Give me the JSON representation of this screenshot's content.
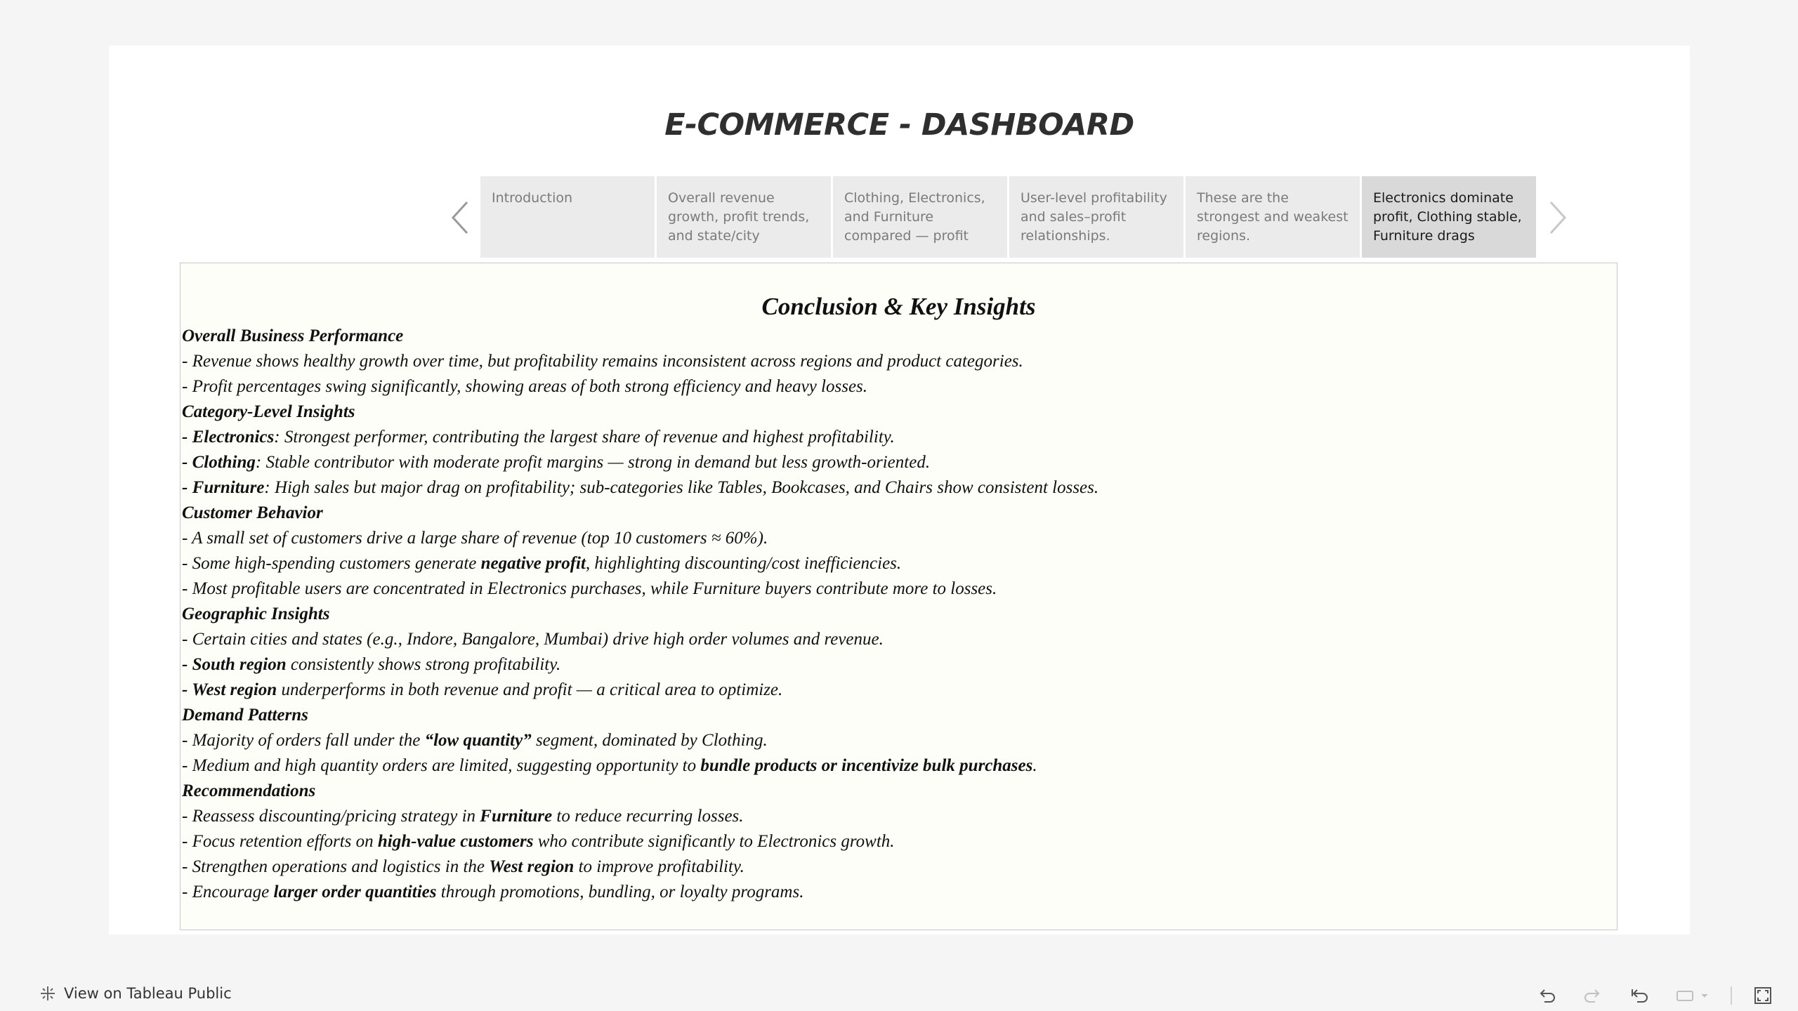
{
  "dashboard": {
    "title": "E-COMMERCE - DASHBOARD"
  },
  "story_points": [
    {
      "label": "Introduction",
      "active": false
    },
    {
      "label": "Overall revenue growth, profit trends, and state/city",
      "active": false
    },
    {
      "label": "Clothing, Electronics, and Furniture compared — profit",
      "active": false
    },
    {
      "label": "User-level profitability and sales–profit relationships.",
      "active": false
    },
    {
      "label": "These are the strongest and weakest regions.",
      "active": false
    },
    {
      "label": "Electronics dominate profit, Clothing stable, Furniture drags",
      "active": true
    }
  ],
  "content": {
    "heading": "Conclusion & Key Insights",
    "sections": {
      "overall": {
        "title": "Overall Business Performance",
        "line1": "- Revenue shows healthy growth over time, but profitability remains inconsistent across regions and product categories.",
        "line2": "- Profit percentages swing significantly, showing areas of both strong efficiency and heavy losses."
      },
      "category": {
        "title": "Category-Level Insights",
        "electronics_label": "- Electronics",
        "electronics_text": ": Strongest performer, contributing the largest share of revenue and highest profitability.",
        "clothing_label": "- Clothing",
        "clothing_text": ": Stable contributor with moderate profit margins — strong in demand but less growth-oriented.",
        "furniture_label": "- Furniture",
        "furniture_text": ": High sales but major drag on profitability; sub-categories like Tables, Bookcases, and Chairs show consistent losses."
      },
      "customer": {
        "title": "Customer Behavior",
        "line1": "- A small set of customers drive a large share of revenue (top 10 customers ≈ 60%).",
        "line2_pre": "- Some high-spending customers generate ",
        "line2_bold": "negative profit",
        "line2_post": ", highlighting discounting/cost inefficiencies.",
        "line3": "- Most profitable users are concentrated in Electronics purchases, while Furniture buyers contribute more to losses."
      },
      "geographic": {
        "title": "Geographic Insights",
        "line1": "- Certain cities and states (e.g., Indore, Bangalore, Mumbai) drive high order volumes and revenue.",
        "south_label": "- South region",
        "south_text": " consistently shows strong profitability.",
        "west_label": "- West region",
        "west_text": " underperforms in both revenue and profit — a critical area to optimize."
      },
      "demand": {
        "title": "Demand Patterns",
        "line1_pre": "- Majority of orders fall under the ",
        "line1_bold": "“low quantity”",
        "line1_post": " segment, dominated by Clothing.",
        "line2_pre": "- Medium and high quantity orders are limited, suggesting opportunity to ",
        "line2_bold": "bundle products or incentivize bulk purchases",
        "line2_post": "."
      },
      "recommendations": {
        "title": "Recommendations",
        "line1_pre": "- Reassess discounting/pricing strategy in ",
        "line1_bold": "Furniture",
        "line1_post": " to reduce recurring losses.",
        "line2_pre": "- Focus retention efforts on ",
        "line2_bold": "high-value customers",
        "line2_post": " who contribute significantly to Electronics growth.",
        "line3_pre": "- Strengthen operations and logistics in the ",
        "line3_bold": "West region",
        "line3_post": " to improve profitability.",
        "line4_pre": "- Encourage ",
        "line4_bold": "larger order quantities",
        "line4_post": " through promotions, bundling, or loyalty programs."
      }
    }
  },
  "footer": {
    "view_link": "View on Tableau Public",
    "tools": [
      "undo-icon",
      "redo-icon",
      "revert-icon",
      "share-icon",
      "fullscreen-icon"
    ]
  },
  "colors": {
    "background": "#f5f5f5",
    "panel": "#ffffff",
    "tab_inactive": "#ebebeb",
    "tab_active": "#d9d9d9",
    "content_background": "#fefef8"
  }
}
